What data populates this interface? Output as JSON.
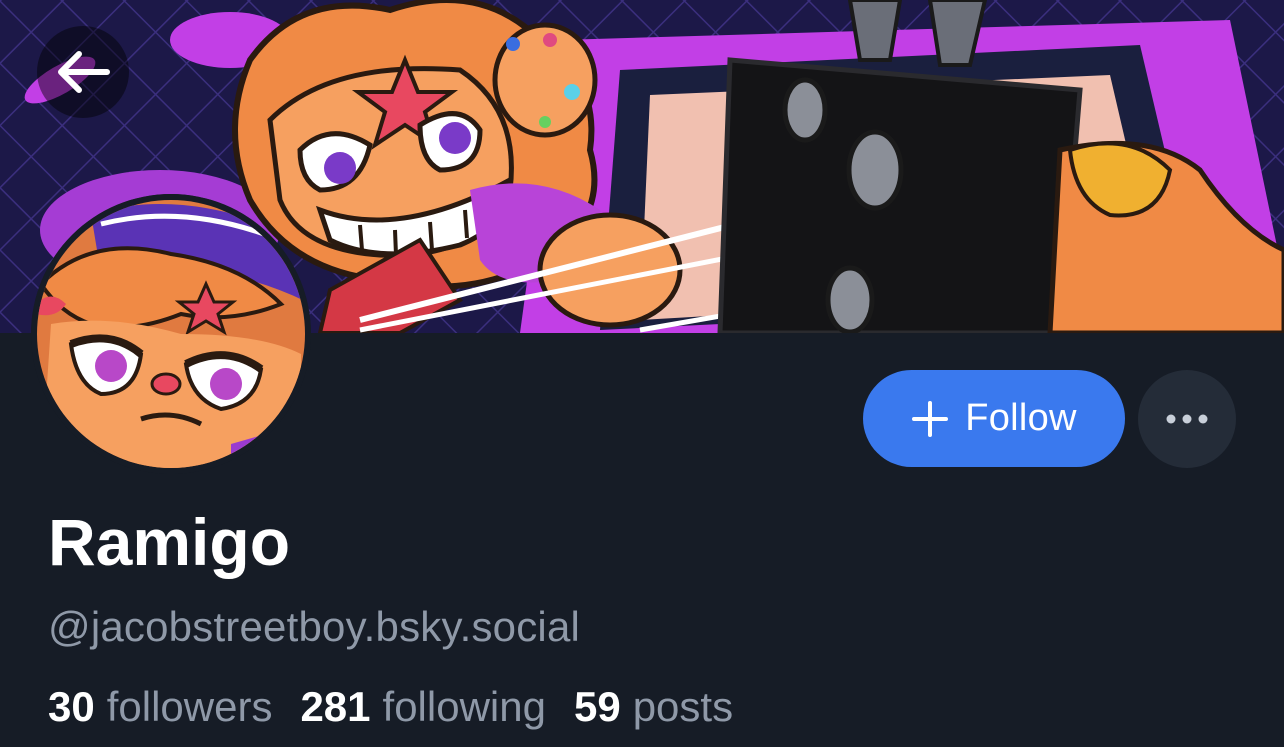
{
  "profile": {
    "display_name": "Ramigo",
    "handle": "@jacobstreetboy.bsky.social"
  },
  "actions": {
    "follow_label": "Follow"
  },
  "stats": [
    {
      "count": "30",
      "label": "followers"
    },
    {
      "count": "281",
      "label": "following"
    },
    {
      "count": "59",
      "label": "posts"
    }
  ],
  "icons": {
    "back": "arrow-left-icon",
    "follow": "plus-icon",
    "more": "ellipsis-icon"
  },
  "colors": {
    "background": "#161c26",
    "accent": "#3a79ee",
    "muted_text": "#8f99a8",
    "more_button": "#242c38"
  }
}
